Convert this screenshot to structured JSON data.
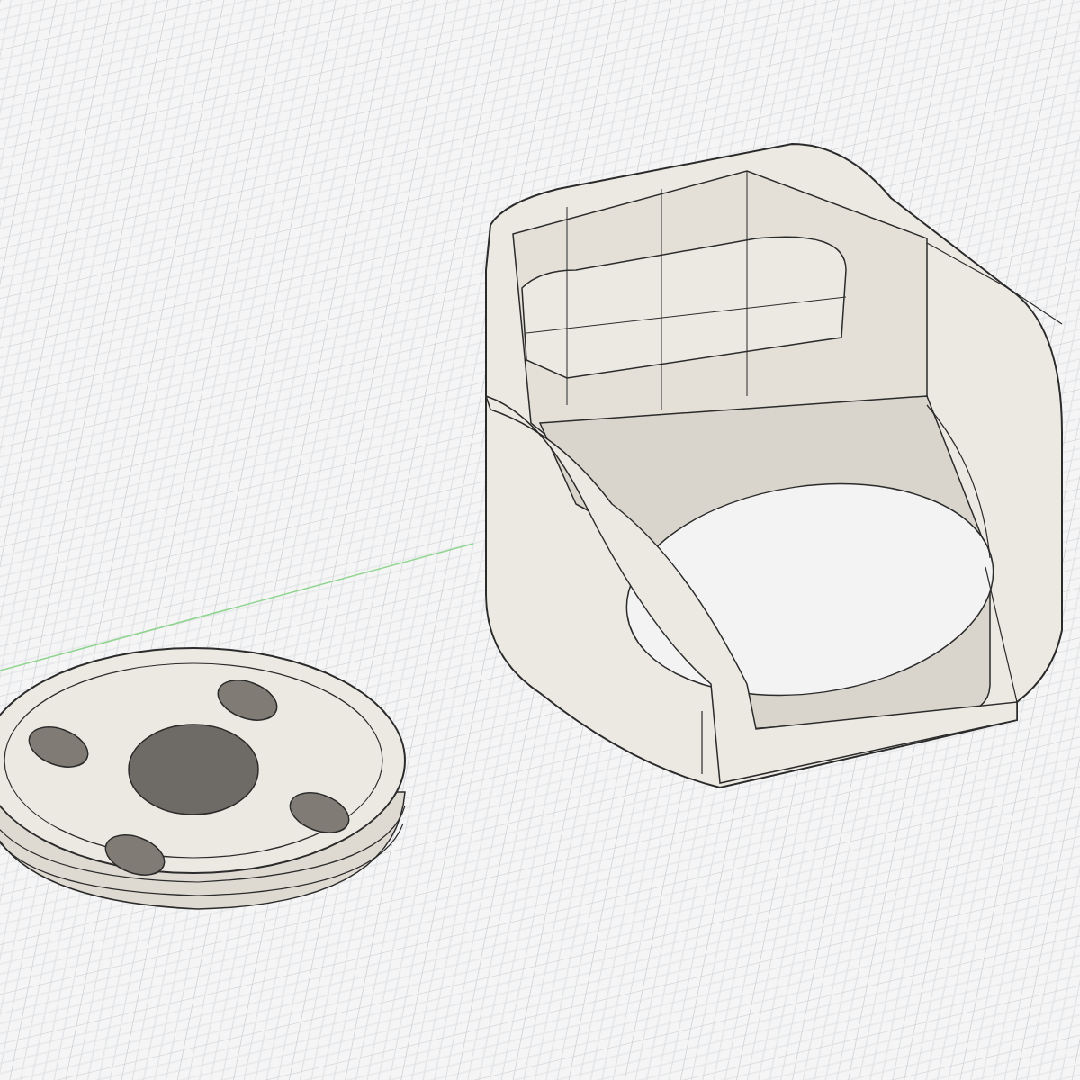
{
  "viewport": {
    "axis": {
      "kind": "x-axis"
    },
    "models": [
      {
        "kind": "holder"
      },
      {
        "kind": "disc"
      }
    ]
  }
}
